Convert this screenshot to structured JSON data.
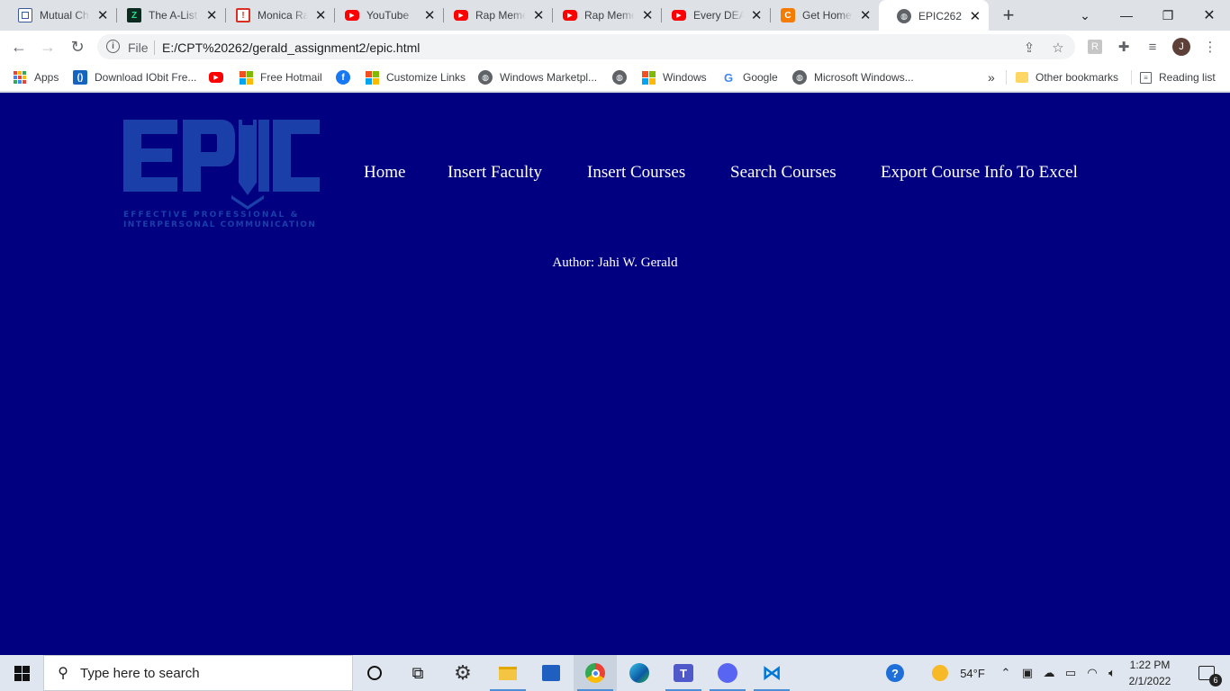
{
  "browser": {
    "tabs": [
      {
        "title": "Mutual Ch",
        "icon": "document-icon",
        "color": "#3c5a99"
      },
      {
        "title": "The A-List",
        "icon": "alist-icon",
        "color": "#0f9d58"
      },
      {
        "title": "Monica Ra",
        "icon": "monica-icon",
        "color": "#d93025"
      },
      {
        "title": "YouTube",
        "icon": "youtube-icon",
        "color": "#ff0000"
      },
      {
        "title": "Rap Meme",
        "icon": "youtube-icon",
        "color": "#ff0000"
      },
      {
        "title": "Rap Meme",
        "icon": "youtube-icon",
        "color": "#ff0000"
      },
      {
        "title": "Every DEA",
        "icon": "youtube-icon",
        "color": "#ff0000"
      },
      {
        "title": "Get Home",
        "icon": "c-icon",
        "color": "#f57c00"
      },
      {
        "title": "EPIC262",
        "icon": "globe-icon",
        "color": "#5f6368",
        "active": true
      }
    ],
    "omnibox": {
      "scheme": "File",
      "url": "E:/CPT%20262/gerald_assignment2/epic.html"
    },
    "profile_initial": "J",
    "bookmarks": [
      {
        "label": "Apps",
        "icon": "apps-grid-icon"
      },
      {
        "label": "Download IObit Fre...",
        "icon": "iobit-icon"
      },
      {
        "label": "",
        "icon": "youtube-icon"
      },
      {
        "label": "Free Hotmail",
        "icon": "microsoft-icon"
      },
      {
        "label": "",
        "icon": "facebook-icon"
      },
      {
        "label": "Customize Links",
        "icon": "microsoft-icon"
      },
      {
        "label": "Windows Marketpl...",
        "icon": "globe-icon"
      },
      {
        "label": "",
        "icon": "globe-icon"
      },
      {
        "label": "Windows",
        "icon": "microsoft-icon"
      },
      {
        "label": "Google",
        "icon": "google-icon"
      },
      {
        "label": "Microsoft Windows...",
        "icon": "globe-icon"
      }
    ],
    "overflow_label": "»",
    "other_bookmarks": "Other bookmarks",
    "reading_list": "Reading list"
  },
  "page": {
    "background": "#000080",
    "logo": {
      "word": "EPIC",
      "tagline_line1": "EFFECTIVE PROFESSIONAL &",
      "tagline_line2": "INTERPERSONAL COMMUNICATION",
      "color": "#1a3fa8"
    },
    "nav": [
      "Home",
      "Insert Faculty",
      "Insert Courses",
      "Search Courses",
      "Export Course Info To Excel"
    ],
    "author": "Author: Jahi W. Gerald"
  },
  "taskbar": {
    "search_placeholder": "Type here to search",
    "weather": "54°F",
    "time": "1:22 PM",
    "date": "2/1/2022",
    "notification_count": "6"
  }
}
